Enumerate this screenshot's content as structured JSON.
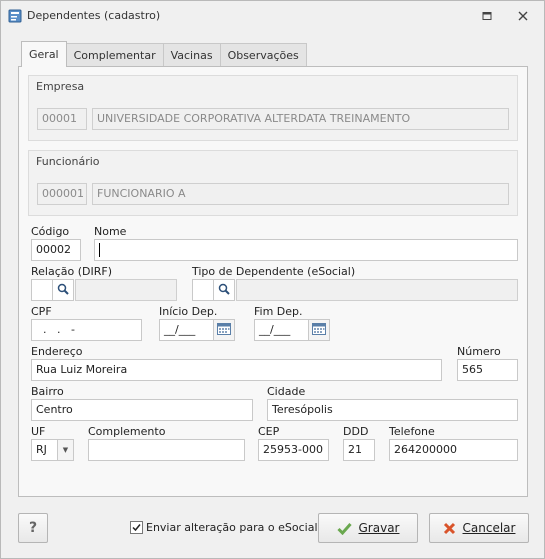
{
  "window": {
    "title": "Dependentes (cadastro)"
  },
  "tabs": [
    {
      "label": "Geral"
    },
    {
      "label": "Complementar"
    },
    {
      "label": "Vacinas"
    },
    {
      "label": "Observações"
    }
  ],
  "empresa": {
    "title": "Empresa",
    "code": "00001",
    "name": "UNIVERSIDADE CORPORATIVA ALTERDATA TREINAMENTO"
  },
  "funcionario": {
    "title": "Funcionário",
    "code": "000001",
    "name": "FUNCIONARIO A"
  },
  "form": {
    "codigo_label": "Código",
    "codigo_value": "00002",
    "nome_label": "Nome",
    "nome_value": "",
    "relacao_label": "Relação (DIRF)",
    "relacao_code": "",
    "relacao_desc": "",
    "tipo_label": "Tipo de Dependente (eSocial)",
    "tipo_code": "",
    "tipo_desc": "",
    "cpf_label": "CPF",
    "cpf_value": "  .   .   -",
    "inicio_label": "Início Dep.",
    "inicio_value": "__/___",
    "fim_label": "Fim Dep.",
    "fim_value": "__/___",
    "endereco_label": "Endereço",
    "endereco_value": "Rua Luiz Moreira",
    "numero_label": "Número",
    "numero_value": "565",
    "bairro_label": "Bairro",
    "bairro_value": "Centro",
    "cidade_label": "Cidade",
    "cidade_value": "Teresópolis",
    "uf_label": "UF",
    "uf_value": "RJ",
    "complemento_label": "Complemento",
    "complemento_value": "",
    "cep_label": "CEP",
    "cep_value": "25953-000",
    "ddd_label": "DDD",
    "ddd_value": "21",
    "telefone_label": "Telefone",
    "telefone_value": "264200000"
  },
  "footer": {
    "help_label": "?",
    "checkbox_label": "Enviar alteração para o eSocial",
    "checkbox_checked": true,
    "save_label": "Gravar",
    "cancel_label": "Cancelar"
  },
  "icons": [
    "app-icon",
    "restore-icon",
    "close-icon",
    "search-icon",
    "calendar-icon",
    "check-icon",
    "cancel-x-icon"
  ],
  "colors": {
    "save_check": "#6aa84f",
    "cancel_x": "#d9542b"
  }
}
